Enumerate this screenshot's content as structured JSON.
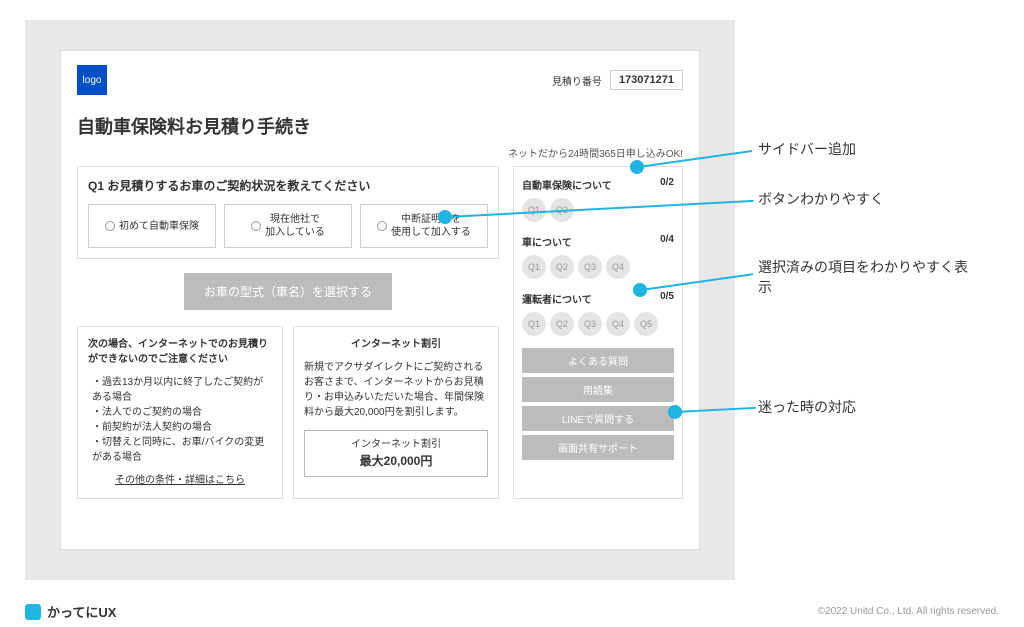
{
  "header": {
    "logo_text": "logo",
    "quote_label": "見積り番号",
    "quote_number": "173071271"
  },
  "page_title": "自動車保険料お見積り手続き",
  "net_ok": "ネットだから24時間365日申し込みOK!",
  "q1": {
    "title": "Q1 お見積りするお車のご契約状況を教えてください",
    "options": [
      "初めて自動車保険",
      "現在他社で\n加入している",
      "中断証明書を\n使用して加入する"
    ]
  },
  "select_button": "お車の型式（車名）を選択する",
  "warning": {
    "title": "次の場合、インターネットでのお見積りができないのでご注意ください",
    "items": [
      "過去13か月以内に終了したご契約がある場合",
      "法人でのご契約の場合",
      "前契約が法人契約の場合",
      "切替えと同時に、お車/バイクの変更がある場合"
    ],
    "link": "その他の条件・詳細はこちら"
  },
  "discount": {
    "title": "インターネット割引",
    "body": "新規でアクサダイレクトにご契約されるお客さまで、インターネットからお見積り・お申込みいただいた場合、年間保険料から最大20,000円を割引します。",
    "box_label": "インターネット割引",
    "box_value": "最大20,000円"
  },
  "sidebar": {
    "sections": [
      {
        "title": "自動車保険について",
        "progress": "0/2",
        "chips": [
          "Q1",
          "Q2"
        ]
      },
      {
        "title": "車について",
        "progress": "0/4",
        "chips": [
          "Q1",
          "Q2",
          "Q3",
          "Q4"
        ]
      },
      {
        "title": "運転者について",
        "progress": "0/5",
        "chips": [
          "Q1",
          "Q2",
          "Q3",
          "Q4",
          "Q5"
        ]
      }
    ],
    "buttons": [
      "よくある質問",
      "用語集",
      "LINEで質問する",
      "画面共有サポート"
    ]
  },
  "annotations": {
    "a1": "サイドバー追加",
    "a2": "ボタンわかりやすく",
    "a3": "選択済みの項目をわかりやすく表示",
    "a4": "迷った時の対応"
  },
  "footer": {
    "brand": "かってにUX",
    "copyright": "©2022 Unitd Co., Ltd. All rights reserved."
  }
}
